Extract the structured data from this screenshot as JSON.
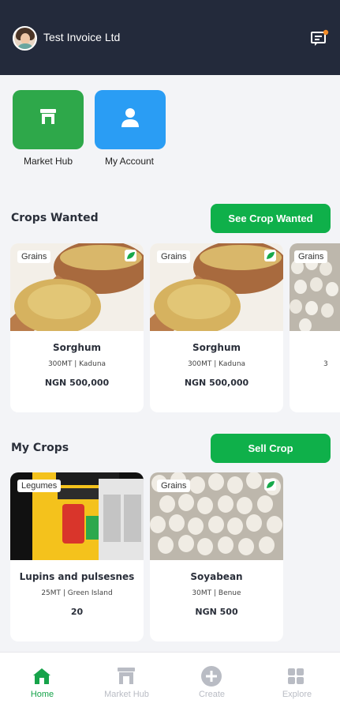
{
  "header": {
    "company_name": "Test Invoice Ltd"
  },
  "shortcuts": [
    {
      "label": "Market Hub",
      "icon": "store-icon"
    },
    {
      "label": "My Account",
      "icon": "person-icon"
    }
  ],
  "crops_wanted": {
    "title": "Crops Wanted",
    "button": "See Crop Wanted",
    "cards": [
      {
        "tag": "Grains",
        "name": "Sorghum",
        "meta": "300MT | Kaduna",
        "price": "NGN 500,000"
      },
      {
        "tag": "Grains",
        "name": "Sorghum",
        "meta": "300MT | Kaduna",
        "price": "NGN 500,000"
      },
      {
        "tag": "Grains",
        "name": "",
        "meta": "3",
        "price": ""
      }
    ]
  },
  "my_crops": {
    "title": "My Crops",
    "button": "Sell Crop",
    "cards": [
      {
        "tag": "Legumes",
        "name": "Lupins and pulsesnes",
        "meta": "25MT | Green Island",
        "price": "20"
      },
      {
        "tag": "Grains",
        "name": "Soyabean",
        "meta": "30MT | Benue",
        "price": "NGN 500"
      }
    ]
  },
  "bottom_nav": [
    {
      "label": "Home",
      "active": true
    },
    {
      "label": "Market Hub",
      "active": false
    },
    {
      "label": "Create",
      "active": false
    },
    {
      "label": "Explore",
      "active": false
    }
  ],
  "colors": {
    "primary_green": "#0fb04a",
    "header_dark": "#232a3b",
    "account_blue": "#2a9df4",
    "nav_active": "#16a34a",
    "nav_inactive": "#b9bcc4"
  }
}
